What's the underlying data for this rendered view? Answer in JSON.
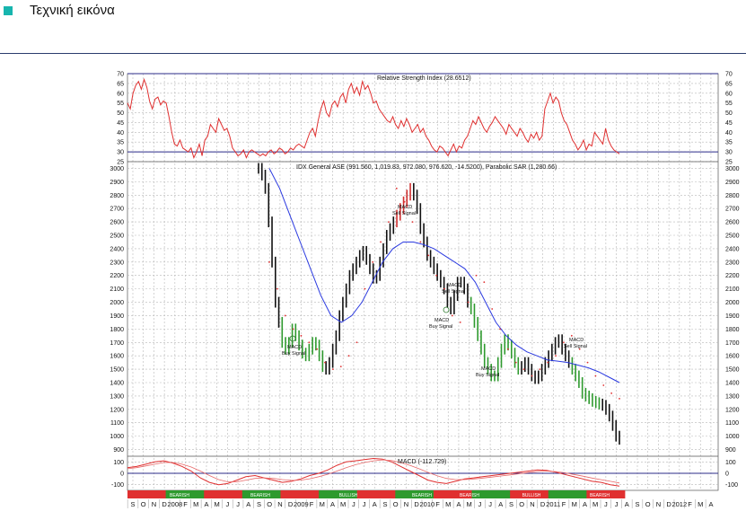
{
  "page": {
    "title": "Τεχνική εικόνα"
  },
  "colors": {
    "accent_square": "#17b5ae",
    "rule": "#2a3c6e"
  },
  "chart_data": [
    {
      "type": "line",
      "title": "Relative Strength Index (28.6512)",
      "y_ticks": [
        25,
        30,
        35,
        40,
        45,
        50,
        55,
        60,
        65,
        70
      ],
      "ylim": [
        25,
        70
      ],
      "reference_lines": [
        30,
        70
      ],
      "series": [
        {
          "color": "#e03030",
          "values": [
            55,
            52,
            60,
            64,
            66,
            62,
            67,
            63,
            56,
            52,
            57,
            58,
            54,
            56,
            55,
            48,
            40,
            34,
            33,
            36,
            32,
            31,
            30,
            32,
            27,
            30,
            34,
            28,
            36,
            38,
            44,
            42,
            40,
            47,
            44,
            41,
            42,
            38,
            32,
            30,
            28,
            29,
            31,
            27,
            30,
            31,
            30,
            29,
            28,
            29,
            28,
            30,
            31,
            29,
            30,
            32,
            31,
            29,
            30,
            32,
            31,
            33,
            34,
            33,
            32,
            36,
            40,
            42,
            38,
            46,
            52,
            56,
            50,
            48,
            54,
            56,
            53,
            58,
            60,
            55,
            62,
            65,
            60,
            63,
            59,
            66,
            62,
            64,
            60,
            55,
            56,
            52,
            50,
            48,
            46,
            45,
            48,
            44,
            42,
            46,
            43,
            47,
            44,
            40,
            42,
            44,
            40,
            42,
            38,
            36,
            33,
            31,
            30,
            33,
            32,
            30,
            28,
            31,
            34,
            30,
            33,
            32,
            36,
            38,
            42,
            46,
            44,
            48,
            45,
            42,
            40,
            43,
            45,
            48,
            46,
            44,
            42,
            39,
            44,
            42,
            40,
            38,
            42,
            40,
            37,
            35,
            39,
            37,
            40,
            36,
            38,
            52,
            56,
            60,
            55,
            58,
            56,
            50,
            46,
            44,
            40,
            36,
            34,
            31,
            33,
            36,
            31,
            34,
            33,
            40,
            38,
            36,
            34,
            42,
            36,
            33,
            31,
            30,
            29
          ]
        }
      ]
    },
    {
      "type": "line",
      "title": "IDX General ASE (991.560, 1,019.83, 972.080, 976.620, -14.5200), Parabolic SAR (1,280.66)",
      "y_ticks": [
        900,
        1000,
        1100,
        1200,
        1300,
        1400,
        1500,
        1600,
        1700,
        1800,
        1900,
        2000,
        2100,
        2200,
        2300,
        2400,
        2500,
        2600,
        2700,
        2800,
        2900,
        3000
      ],
      "ylim": [
        850,
        3050
      ],
      "annotations": [
        "MACD Buy Signal",
        "MACD Sell Signal",
        "MACD Sell Signal",
        "MACD Buy Signal",
        "MACD Buy Signal",
        "MACD Sell Signal"
      ],
      "series": [
        {
          "name": "IDX General ASE",
          "color": "#111111",
          "values": [
            3000,
            2950,
            2850,
            2600,
            2300,
            2000,
            1850,
            1700,
            1650,
            1700,
            1800,
            1750,
            1680,
            1620,
            1600,
            1650,
            1700,
            1680,
            1600,
            1520,
            1500,
            1550,
            1650,
            1750,
            1900,
            2000,
            2100,
            2200,
            2250,
            2300,
            2350,
            2380,
            2320,
            2250,
            2180,
            2200,
            2300,
            2400,
            2500,
            2550,
            2600,
            2650,
            2700,
            2750,
            2800,
            2850,
            2800,
            2700,
            2550,
            2450,
            2350,
            2300,
            2250,
            2200,
            2150,
            2100,
            2000,
            1950,
            2050,
            2150,
            2150,
            2100,
            2000,
            1950,
            1850,
            1750,
            1650,
            1550,
            1500,
            1450,
            1450,
            1550,
            1650,
            1720,
            1680,
            1620,
            1550,
            1500,
            1520,
            1550,
            1500,
            1450,
            1430,
            1450,
            1500,
            1550,
            1600,
            1650,
            1700,
            1720,
            1650,
            1600,
            1550,
            1500,
            1450,
            1400,
            1320,
            1300,
            1280,
            1260,
            1250,
            1240,
            1230,
            1200,
            1150,
            1080,
            1000,
            976.62
          ]
        },
        {
          "name": "Moving average",
          "color": "#2b3ae0",
          "values": [
            3000,
            2850,
            2650,
            2450,
            2250,
            2050,
            1900,
            1850,
            1900,
            2000,
            2150,
            2300,
            2400,
            2450,
            2450,
            2430,
            2400,
            2350,
            2300,
            2250,
            2150,
            2000,
            1850,
            1750,
            1680,
            1630,
            1600,
            1570,
            1560,
            1550,
            1530,
            1510,
            1480,
            1440,
            1400
          ]
        },
        {
          "name": "Parabolic SAR",
          "color": "#e03030",
          "values": [
            2300,
            2100,
            1900,
            1800,
            1750,
            1700,
            1650,
            1550,
            1500,
            1520,
            1600,
            1700,
            2100,
            2300,
            2450,
            2600,
            2850,
            2750,
            2600,
            2450,
            2350,
            2200,
            2100,
            1900,
            1850,
            2000,
            2200,
            2150,
            1950,
            1800,
            1650,
            1550,
            1500,
            1450,
            1500,
            1550,
            1600,
            1700,
            1750,
            1650,
            1550,
            1450,
            1380,
            1320,
            1280
          ]
        }
      ]
    },
    {
      "type": "line",
      "title": "MACD (-112.729)",
      "y_ticks": [
        -100,
        0,
        100
      ],
      "ylim": [
        -150,
        150
      ],
      "series": [
        {
          "name": "MACD",
          "color": "#e03030",
          "values": [
            50,
            60,
            80,
            100,
            110,
            90,
            60,
            20,
            -40,
            -80,
            -100,
            -90,
            -60,
            -30,
            -20,
            -40,
            -60,
            -80,
            -70,
            -50,
            -20,
            0,
            30,
            70,
            100,
            110,
            120,
            130,
            125,
            100,
            60,
            20,
            -20,
            -60,
            -80,
            -90,
            -70,
            -50,
            -40,
            -30,
            -20,
            -10,
            0,
            10,
            20,
            30,
            25,
            10,
            -10,
            -30,
            -50,
            -70,
            -80,
            -100,
            -112.729
          ]
        },
        {
          "name": "Signal",
          "color": "#e86a6a",
          "values": [
            40,
            50,
            65,
            80,
            95,
            95,
            80,
            55,
            20,
            -20,
            -55,
            -75,
            -75,
            -60,
            -45,
            -40,
            -45,
            -55,
            -62,
            -60,
            -48,
            -30,
            -8,
            20,
            50,
            75,
            95,
            110,
            118,
            112,
            95,
            70,
            40,
            8,
            -22,
            -45,
            -55,
            -55,
            -50,
            -42,
            -33,
            -24,
            -14,
            -4,
            6,
            16,
            20,
            15,
            5,
            -10,
            -25,
            -42,
            -56,
            -70,
            -85
          ]
        }
      ]
    }
  ],
  "x_axis": {
    "month_labels": [
      "S",
      "O",
      "N",
      "D",
      "2008",
      "F",
      "M",
      "A",
      "M",
      "J",
      "J",
      "A",
      "S",
      "O",
      "N",
      "D",
      "2009",
      "F",
      "M",
      "A",
      "M",
      "J",
      "J",
      "A",
      "S",
      "O",
      "N",
      "D",
      "2010",
      "F",
      "M",
      "A",
      "M",
      "J",
      "J",
      "A",
      "S",
      "O",
      "N",
      "D",
      "2011",
      "F",
      "M",
      "A",
      "M",
      "J",
      "J",
      "A",
      "S",
      "O",
      "N",
      "D",
      "2012",
      "F",
      "M",
      "A",
      "M"
    ],
    "signal_bar_labels": [
      "BEARISH",
      "BEARISH",
      "BULLISH",
      "BEARISH",
      "BEARISH",
      "BULLISH",
      "BEARISH"
    ],
    "signal_bar_segments": [
      {
        "state": "bearish",
        "color": "#e03030"
      },
      {
        "state": "bullish",
        "color": "#2e9a2e"
      },
      {
        "state": "bearish",
        "color": "#e03030"
      },
      {
        "state": "bullish",
        "color": "#2e9a2e"
      },
      {
        "state": "bearish",
        "color": "#e03030"
      },
      {
        "state": "bullish",
        "color": "#2e9a2e"
      },
      {
        "state": "bearish",
        "color": "#e03030"
      },
      {
        "state": "bullish",
        "color": "#2e9a2e"
      },
      {
        "state": "bearish",
        "color": "#e03030"
      },
      {
        "state": "bullish",
        "color": "#2e9a2e"
      },
      {
        "state": "bearish",
        "color": "#e03030"
      },
      {
        "state": "bullish",
        "color": "#2e9a2e"
      },
      {
        "state": "bearish",
        "color": "#e03030"
      }
    ]
  }
}
